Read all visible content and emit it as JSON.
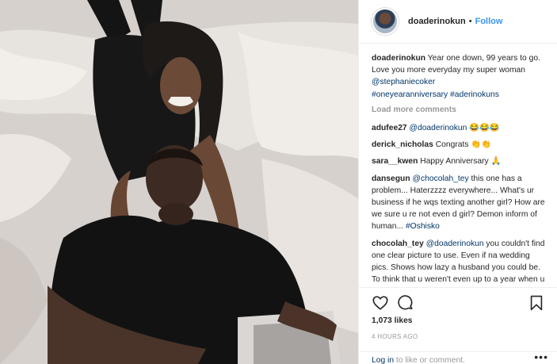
{
  "post": {
    "author": "doaderinokun",
    "separator": "•",
    "follow_label": "Follow",
    "caption": {
      "username": "doaderinokun",
      "text": " Year one down, 99 years to go. Love you more everyday my super woman ",
      "mention": "@stephaniecoker",
      "space": " ",
      "hashtag1": "#oneyearanniversary",
      "hashtag2": "#aderinokuns"
    },
    "load_more_label": "Load more comments"
  },
  "comments": [
    {
      "username": "adufee27",
      "mention": "@doaderinokun",
      "text": " 😂😂😂"
    },
    {
      "username": "derick_nicholas",
      "text": " Congrats 👏👏"
    },
    {
      "username": "sara__kwen",
      "text": " Happy Anniversary 🙏"
    },
    {
      "username": "dansegun",
      "mention": "@chocolah_tey",
      "text": " this one has a problem... Haterzzzz everywhere... What's ur business if he wqs texting another girl? How are we sure u re not even d girl? Demon inform of human... ",
      "hashtag": "#Oshisko"
    },
    {
      "username": "chocolah_tey",
      "mention": "@doaderinokun",
      "text": " you couldn't find one clear picture to use. Even if na wedding pics. Shows how lazy a husband you could be. To think that u weren't even up to a year when u were texting that Babcock girl, whatever her"
    }
  ],
  "footer": {
    "likes": "1,073 likes",
    "timestamp": "4 HOURS AGO",
    "login_link": "Log in",
    "login_text": " to like or comment.",
    "more_glyph": "•••"
  },
  "icons": {
    "like": "heart-icon",
    "comment": "comment-bubble-icon",
    "save": "bookmark-icon",
    "more": "ellipsis-icon"
  },
  "colors": {
    "link_blue": "#3897f0",
    "mention_blue": "#003569",
    "muted_gray": "#999999",
    "text": "#262626",
    "border": "#efefef"
  }
}
